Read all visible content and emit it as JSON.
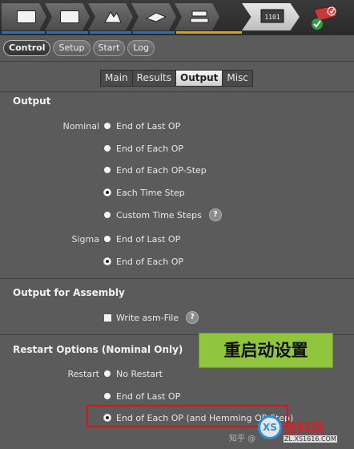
{
  "workflow": {
    "steps": [
      "geometry-step-icon",
      "process-step-icon",
      "material-step-icon",
      "part-step-icon",
      "tools-step-icon",
      "control-step-icon",
      "status-ok-icon"
    ],
    "active_step_label": "1101",
    "accent_colors": [
      "#2f6fb7",
      "#2f6fb7",
      "#2f6fb7",
      "#2f6fb7",
      "#d4a21e"
    ]
  },
  "control_tabs": [
    "Control",
    "Setup",
    "Start",
    "Log"
  ],
  "sub_tabs": [
    "Main",
    "Results",
    "Output",
    "Misc"
  ],
  "output": {
    "title": "Output",
    "nominal_label": "Nominal",
    "nominal_options": [
      "End of Last OP",
      "End of Each OP",
      "End of Each OP-Step",
      "Each Time Step",
      "Custom Time Steps"
    ],
    "sigma_label": "Sigma",
    "sigma_options": [
      "End of Last OP",
      "End of Each OP"
    ]
  },
  "assembly": {
    "title": "Output for Assembly",
    "checkbox_label": "Write asm-File"
  },
  "restart": {
    "title": "Restart Options (Nominal Only)",
    "label": "Restart",
    "options": [
      "No Restart",
      "End of Last OP",
      "End of Each OP (and Hemming OP-Step)"
    ]
  },
  "help_glyph": "?",
  "annotation": "重启动设置",
  "watermark": {
    "text": "知乎 @",
    "logo_text": "资料网",
    "logo_url": "ZL.XS1616.COM",
    "logo_mark": "XS"
  }
}
